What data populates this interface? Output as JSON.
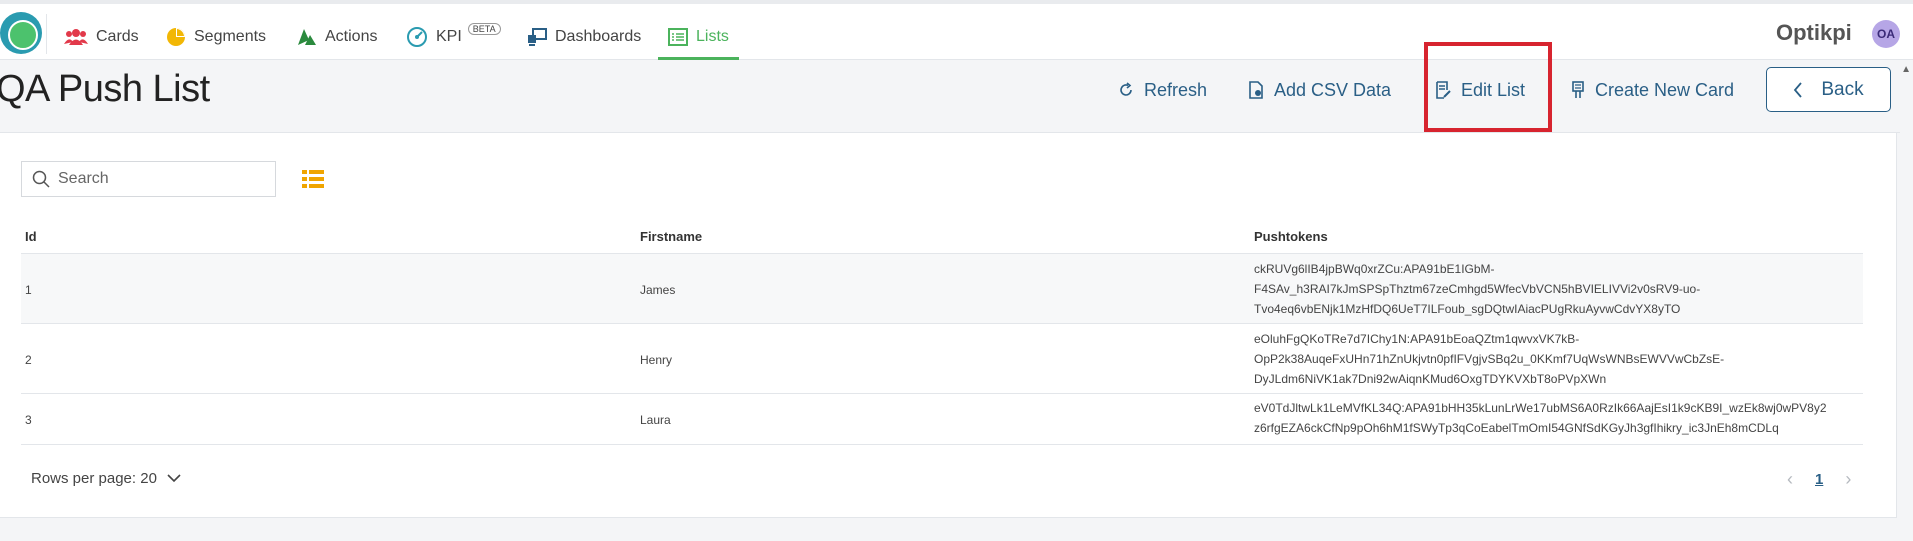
{
  "nav": {
    "items": [
      {
        "label": "Cards",
        "icon": "users-icon"
      },
      {
        "label": "Segments",
        "icon": "pie-chart-icon"
      },
      {
        "label": "Actions",
        "icon": "actions-icon"
      },
      {
        "label": "KPI",
        "icon": "gauge-icon",
        "badge": "BETA"
      },
      {
        "label": "Dashboards",
        "icon": "dashboard-icon"
      },
      {
        "label": "Lists",
        "icon": "list-icon",
        "active": true
      }
    ],
    "brand": "Optikpi",
    "avatar_initials": "OA"
  },
  "header": {
    "title": "QA Push List",
    "refresh_label": "Refresh",
    "add_csv_label": "Add CSV Data",
    "edit_list_label": "Edit List",
    "create_card_label": "Create New Card",
    "back_label": "Back"
  },
  "search": {
    "placeholder": "Search",
    "value": ""
  },
  "table": {
    "columns": [
      "Id",
      "Firstname",
      "Pushtokens"
    ],
    "rows": [
      {
        "id": "1",
        "firstname": "James",
        "token_lines": [
          "ckRUVg6lIB4jpBWq0xrZCu:APA91bE1IGbM-",
          "F4SAv_h3RAI7kJmSPSpThztm67zeCmhgd5WfecVbVCN5hBVIELIVVi2v0sRV9-uo-",
          "Tvo4eq6vbENjk1MzHfDQ6UeT7ILFoub_sgDQtwIAiacPUgRkuAyvwCdvYX8yTO"
        ]
      },
      {
        "id": "2",
        "firstname": "Henry",
        "token_lines": [
          "eOluhFgQKoTRe7d7IChy1N:APA91bEoaQZtm1qwvxVK7kB-",
          "OpP2k38AuqeFxUHn71hZnUkjvtn0pfIFVgjvSBq2u_0KKmf7UqWsWNBsEWVVwCbZsE-",
          "DyJLdm6NiVK1ak7Dni92wAiqnKMud6OxgTDYKVXbT8oPVpXWn"
        ]
      },
      {
        "id": "3",
        "firstname": "Laura",
        "token_lines": [
          "eV0TdJltwLk1LeMVfKL34Q:APA91bHH35kLunLrWe17ubMS6A0RzIk66AajEsI1k9cKB9I_wzEk8wj0wPV8y2",
          "z6rfgEZA6ckCfNp9pOh6hM1fSWyTp3qCoEabelTmOmI54GNfSdKGyJh3gfIhikry_ic3JnEh8mCDLq"
        ]
      }
    ]
  },
  "footer": {
    "rows_per_page_label": "Rows per page: 20",
    "current_page": "1"
  },
  "colors": {
    "accent_green": "#4bb35c",
    "link_blue": "#2a5f86",
    "list_view_orange": "#f0a500",
    "highlight_red": "#d7242f"
  }
}
